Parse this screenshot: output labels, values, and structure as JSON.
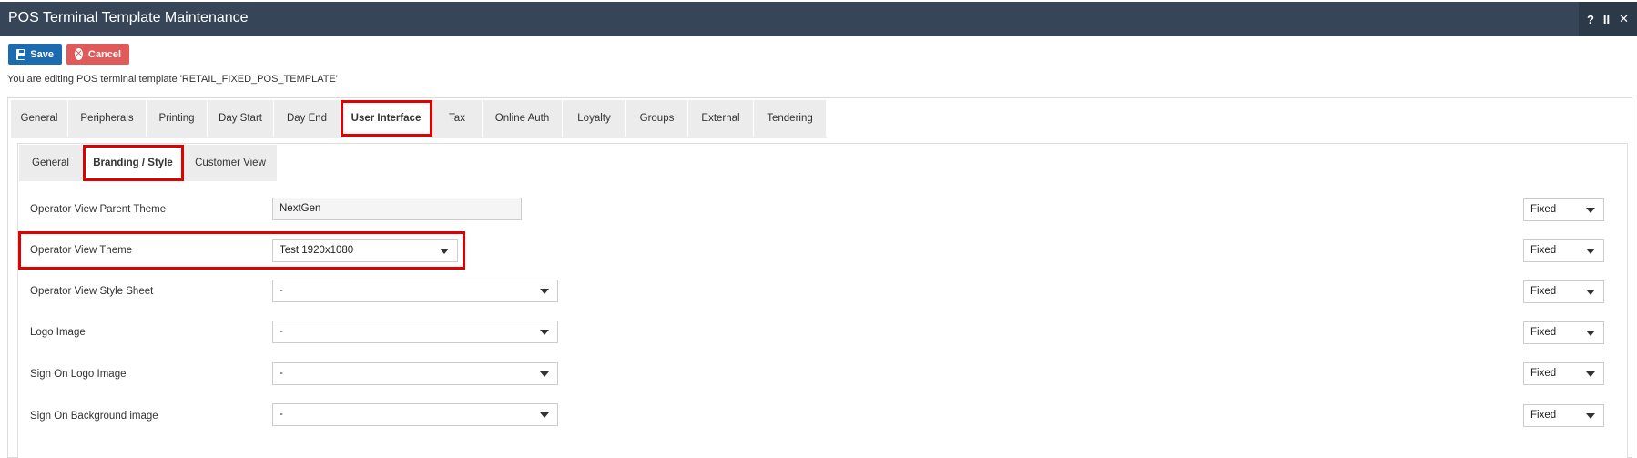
{
  "window": {
    "title": "POS Terminal Template Maintenance",
    "controls": [
      "?",
      "II",
      "✕"
    ]
  },
  "toolbar": {
    "save_label": "Save",
    "cancel_label": "Cancel"
  },
  "info_text": "You are editing POS terminal template 'RETAIL_FIXED_POS_TEMPLATE'",
  "main_tabs": [
    {
      "label": "General"
    },
    {
      "label": "Peripherals"
    },
    {
      "label": "Printing"
    },
    {
      "label": "Day Start"
    },
    {
      "label": "Day End"
    },
    {
      "label": "User Interface"
    },
    {
      "label": "Tax"
    },
    {
      "label": "Online Auth"
    },
    {
      "label": "Loyalty"
    },
    {
      "label": "Groups"
    },
    {
      "label": "External"
    },
    {
      "label": "Tendering"
    }
  ],
  "active_main_tab": "User Interface",
  "sub_tabs": [
    {
      "label": "General"
    },
    {
      "label": "Branding / Style"
    },
    {
      "label": "Customer View"
    }
  ],
  "active_sub_tab": "Branding / Style",
  "form": {
    "rows": [
      {
        "label": "Operator View Parent Theme",
        "value": "NextGen",
        "mode": "Fixed"
      },
      {
        "label": "Operator View Theme",
        "value": "Test 1920x1080",
        "mode": "Fixed"
      },
      {
        "label": "Operator View Style Sheet",
        "value": "-",
        "mode": "Fixed"
      },
      {
        "label": "Logo Image",
        "value": "-",
        "mode": "Fixed"
      },
      {
        "label": "Sign On Logo Image",
        "value": "-",
        "mode": "Fixed"
      },
      {
        "label": "Sign On Background image",
        "value": "-",
        "mode": "Fixed"
      }
    ]
  },
  "colors": {
    "titlebar": "#364557",
    "save": "#1c6bb1",
    "cancel": "#e05a5a",
    "highlight": "#e00000"
  }
}
